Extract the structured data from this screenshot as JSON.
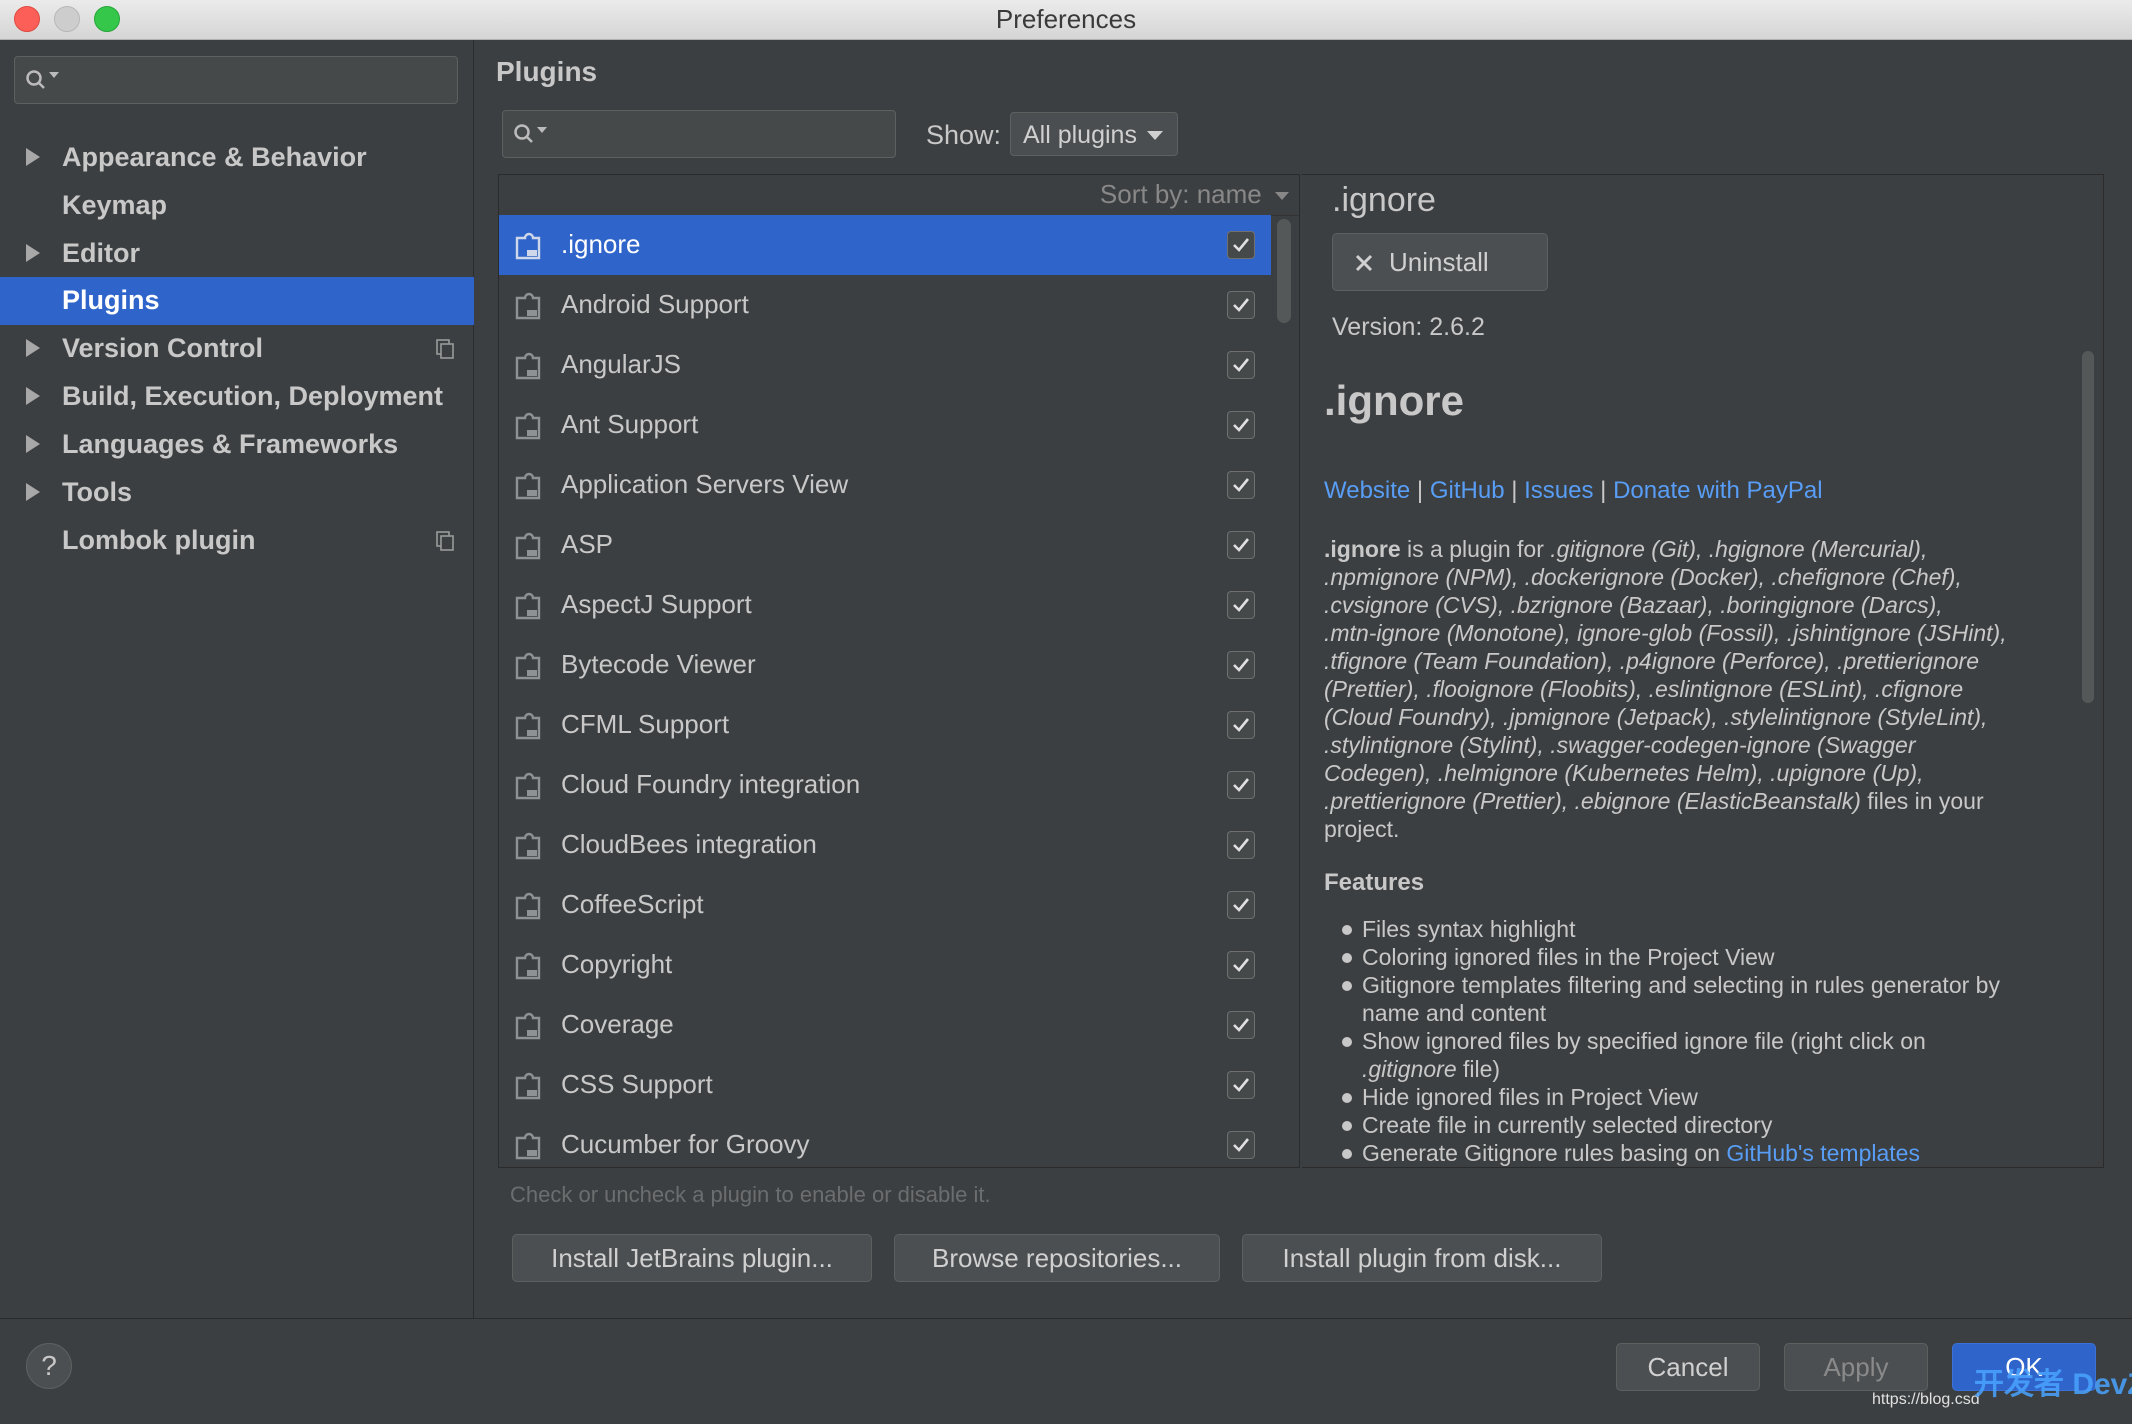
{
  "window": {
    "title": "Preferences"
  },
  "sidebar": {
    "search_value": "",
    "items": [
      {
        "label": "Appearance & Behavior",
        "expandable": true
      },
      {
        "label": "Keymap",
        "expandable": false
      },
      {
        "label": "Editor",
        "expandable": true
      },
      {
        "label": "Plugins",
        "expandable": false,
        "selected": true
      },
      {
        "label": "Version Control",
        "expandable": true
      },
      {
        "label": "Build, Execution, Deployment",
        "expandable": true
      },
      {
        "label": "Languages & Frameworks",
        "expandable": true
      },
      {
        "label": "Tools",
        "expandable": true
      },
      {
        "label": "Lombok plugin",
        "expandable": false
      }
    ]
  },
  "main": {
    "title": "Plugins",
    "search_value": "",
    "show_label": "Show:",
    "show_value": "All plugins",
    "sort_label": "Sort by: name"
  },
  "plugins": [
    {
      "name": ".ignore",
      "checked": true,
      "selected": true
    },
    {
      "name": "Android Support",
      "checked": true
    },
    {
      "name": "AngularJS",
      "checked": true
    },
    {
      "name": "Ant Support",
      "checked": true
    },
    {
      "name": "Application Servers View",
      "checked": true
    },
    {
      "name": "ASP",
      "checked": true
    },
    {
      "name": "AspectJ Support",
      "checked": true
    },
    {
      "name": "Bytecode Viewer",
      "checked": true
    },
    {
      "name": "CFML Support",
      "checked": true
    },
    {
      "name": "Cloud Foundry integration",
      "checked": true
    },
    {
      "name": "CloudBees integration",
      "checked": true
    },
    {
      "name": "CoffeeScript",
      "checked": true
    },
    {
      "name": "Copyright",
      "checked": true
    },
    {
      "name": "Coverage",
      "checked": true
    },
    {
      "name": "CSS Support",
      "checked": true
    },
    {
      "name": "Cucumber for Groovy",
      "checked": true
    }
  ],
  "detail": {
    "name": ".ignore",
    "uninstall_label": "Uninstall",
    "version": "Version: 2.6.2",
    "heading": ".ignore",
    "links": [
      "Website",
      "GitHub",
      "Issues",
      "Donate with PayPal"
    ],
    "link_separator": "|",
    "description_lines": [
      "<b>.ignore</b> is a plugin for <i>.gitignore (Git), .hgignore (Mercurial),</i>",
      "<i>.npmignore (NPM), .dockerignore (Docker), .chefignore (Chef),</i>",
      "<i>.cvsignore (CVS), .bzrignore (Bazaar), .boringignore (Darcs),</i>",
      "<i>.mtn-ignore (Monotone), ignore-glob (Fossil), .jshintignore (JSHint),</i>",
      "<i>.tfignore (Team Foundation), .p4ignore (Perforce), .prettierignore</i>",
      "<i>(Prettier), .flooignore (Floobits), .eslintignore (ESLint), .cfignore</i>",
      "<i>(Cloud Foundry), .jpmignore (Jetpack), .stylelintignore (StyleLint),</i>",
      "<i>.stylintignore (Stylint), .swagger-codegen-ignore (Swagger</i>",
      "<i>Codegen), .helmignore (Kubernetes Helm), .upignore (Up),</i>",
      "<i>.prettierignore (Prettier), .ebignore (ElasticBeanstalk)</i> files in your",
      "project."
    ],
    "features_title": "Features",
    "features": [
      [
        "Files syntax highlight"
      ],
      [
        "Coloring ignored files in the Project View"
      ],
      [
        "Gitignore templates filtering and selecting in rules generator by",
        "name and content"
      ],
      [
        "Show ignored files by specified ignore file (right click on",
        "<i>.gitignore</i> file)"
      ],
      [
        "Hide ignored files in Project View"
      ],
      [
        "Create file in currently selected directory"
      ],
      [
        "Generate Gitignore rules basing on <span class=\"link\">GitHub's templates</span>"
      ]
    ]
  },
  "hint": "Check or uncheck a plugin to enable or disable it.",
  "buttons": {
    "install_jetbrains": "Install JetBrains plugin...",
    "browse": "Browse repositories...",
    "install_disk": "Install plugin from disk...",
    "cancel": "Cancel",
    "apply": "Apply",
    "ok": "OK",
    "help": "?"
  },
  "watermark": {
    "text": "开发者 DevZe.CoM",
    "url": "https://blog.csd"
  },
  "colors": {
    "accent": "#2f65ca",
    "link": "#589df6",
    "background": "#3c3f41"
  }
}
